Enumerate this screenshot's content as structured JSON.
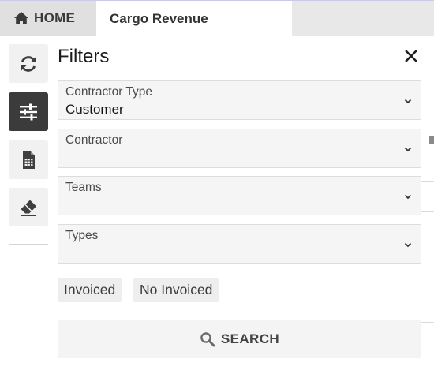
{
  "tabs": {
    "home": {
      "label": "HOME",
      "icon": "home-icon"
    },
    "active": {
      "label": "Cargo Revenue"
    }
  },
  "toolbar": [
    {
      "icon": "refresh-icon",
      "active": false
    },
    {
      "icon": "sliders-icon",
      "active": true
    },
    {
      "icon": "spreadsheet-icon",
      "active": false
    },
    {
      "icon": "eraser-icon",
      "active": false
    }
  ],
  "filters": {
    "title": "Filters",
    "close_icon": "close-icon",
    "fields": [
      {
        "label": "Contractor Type",
        "value": "Customer"
      },
      {
        "label": "Contractor",
        "value": ""
      },
      {
        "label": "Teams",
        "value": ""
      },
      {
        "label": "Types",
        "value": ""
      }
    ],
    "chips": [
      "Invoiced",
      "No Invoiced"
    ],
    "search_label": "SEARCH",
    "search_icon": "search-icon"
  },
  "colors": {
    "tabbar_bg": "#e8e8e8",
    "active_toolbar_bg": "#3b3b3b",
    "field_bg": "#f5f5f5",
    "field_border": "#dcdcdc"
  }
}
